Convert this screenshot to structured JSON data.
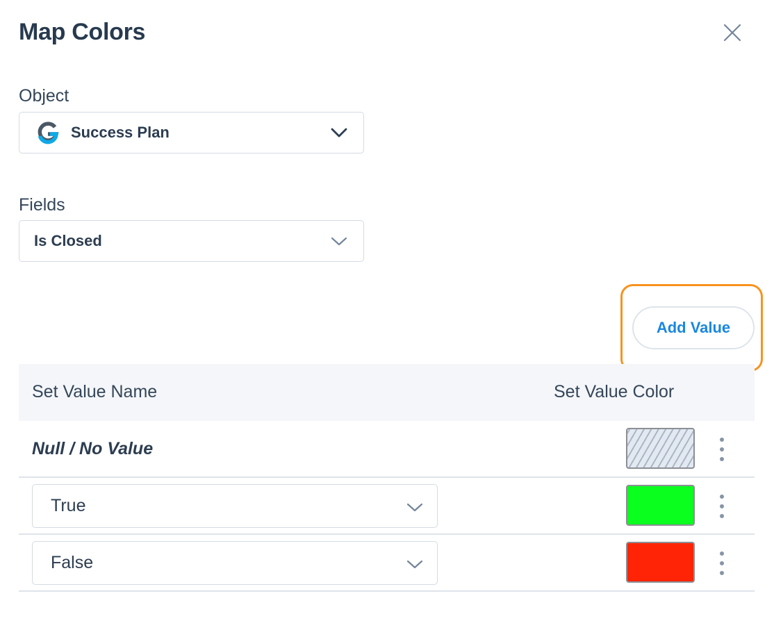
{
  "modal": {
    "title": "Map Colors"
  },
  "object": {
    "label": "Object",
    "selected": "Success Plan",
    "icon": "gainsight-logo-icon"
  },
  "fields": {
    "label": "Fields",
    "selected": "Is Closed"
  },
  "actions": {
    "add_value_label": "Add Value",
    "highlight_color": "#f7931e"
  },
  "table": {
    "headers": {
      "name": "Set Value Name",
      "color": "Set Value Color"
    },
    "rows": [
      {
        "name": "Null / No Value",
        "color": "hatched"
      },
      {
        "name": "True",
        "color": "#0bff1e"
      },
      {
        "name": "False",
        "color": "#ff2406"
      }
    ]
  }
}
